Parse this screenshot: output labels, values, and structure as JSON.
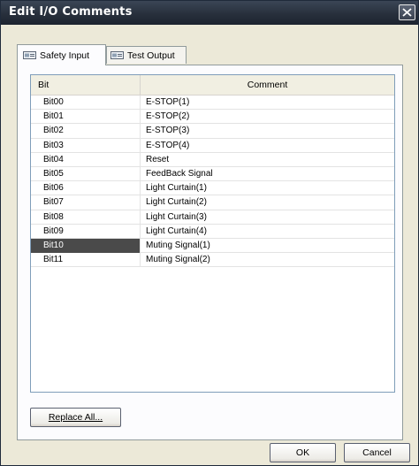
{
  "window": {
    "title": "Edit I/O Comments",
    "close_label": "×"
  },
  "tabs": [
    {
      "label": "Safety Input",
      "active": true,
      "icon": "io-module-icon"
    },
    {
      "label": "Test Output",
      "active": false,
      "icon": "io-module-icon"
    }
  ],
  "table": {
    "columns": [
      "Bit",
      "Comment"
    ],
    "rows": [
      {
        "bit": "Bit00",
        "comment": "E-STOP(1)"
      },
      {
        "bit": "Bit01",
        "comment": "E-STOP(2)"
      },
      {
        "bit": "Bit02",
        "comment": "E-STOP(3)"
      },
      {
        "bit": "Bit03",
        "comment": "E-STOP(4)"
      },
      {
        "bit": "Bit04",
        "comment": "Reset"
      },
      {
        "bit": "Bit05",
        "comment": "FeedBack Signal"
      },
      {
        "bit": "Bit06",
        "comment": "Light Curtain(1)"
      },
      {
        "bit": "Bit07",
        "comment": "Light Curtain(2)"
      },
      {
        "bit": "Bit08",
        "comment": "Light Curtain(3)"
      },
      {
        "bit": "Bit09",
        "comment": "Light Curtain(4)"
      },
      {
        "bit": "Bit10",
        "comment": "Muting Signal(1)",
        "selected": true
      },
      {
        "bit": "Bit11",
        "comment": "Muting Signal(2)"
      }
    ]
  },
  "buttons": {
    "replace_all": "Replace All...",
    "ok": "OK",
    "cancel": "Cancel"
  },
  "colors": {
    "titlebar": "#262e3a",
    "dialog_bg": "#ece9d8",
    "selected_row": "#4a4a4a"
  }
}
